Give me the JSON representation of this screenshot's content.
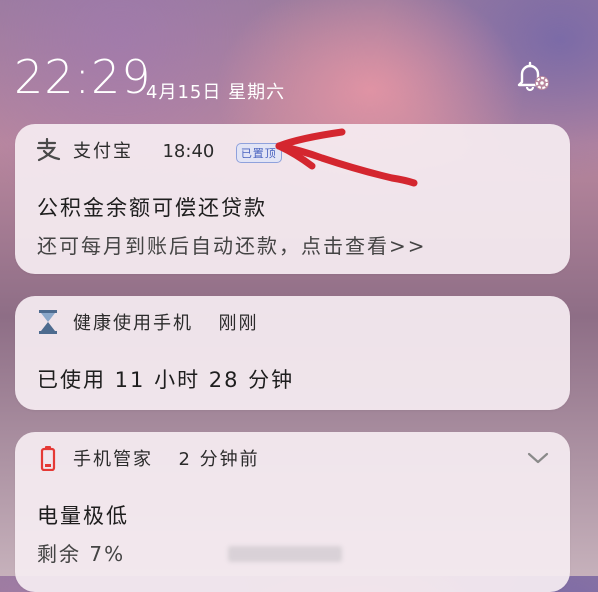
{
  "status_bar": {
    "time": "22:29",
    "date": "4月15日 星期六",
    "notification_settings_icon": "bell-gear-icon"
  },
  "notifications": [
    {
      "app_icon": "alipay-icon",
      "app_name": "支付宝",
      "time": "18:40",
      "badge": "已置顶",
      "title": "公积金余额可偿还贷款",
      "body": "还可每月到账后自动还款，点击查看>>"
    },
    {
      "app_icon": "hourglass-icon",
      "app_name": "健康使用手机",
      "time": "刚刚",
      "title": "已使用 11 小时 28 分钟"
    },
    {
      "app_icon": "battery-low-icon",
      "app_name": "手机管家",
      "time": "2 分钟前",
      "title": "电量极低",
      "body": "剩余 7%"
    }
  ],
  "colors": {
    "annotation_arrow": "#d4262f",
    "badge_text": "#4a64c0",
    "battery_low": "#e53935",
    "hourglass": "#4d6b8f"
  }
}
